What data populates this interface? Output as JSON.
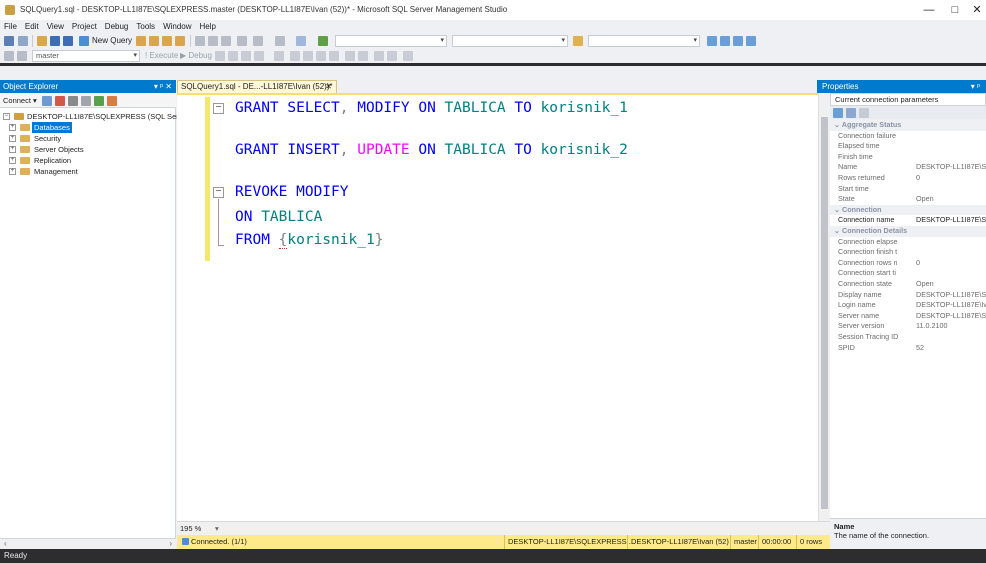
{
  "window": {
    "title": "SQLQuery1.sql - DESKTOP-LL1I87E\\SQLEXPRESS.master (DESKTOP-LL1I87E\\Ivan (52))* - Microsoft SQL Server Management Studio",
    "minimize": "—",
    "maximize": "□",
    "close": "✕"
  },
  "menu": [
    "File",
    "Edit",
    "View",
    "Project",
    "Debug",
    "Tools",
    "Window",
    "Help"
  ],
  "toolbar": {
    "new_query": "New Query",
    "database": "master",
    "execute": "Execute",
    "debug": "Debug"
  },
  "object_explorer": {
    "title": "Object Explorer",
    "controls": "▾ ᵖ ✕",
    "connect": "Connect ▾",
    "server_node": "DESKTOP-LL1I87E\\SQLEXPRESS (SQL Ser",
    "nodes": [
      "Databases",
      "Security",
      "Server Objects",
      "Replication",
      "Management"
    ]
  },
  "document_tab": {
    "label": "SQLQuery1.sql - DE...-LL1I87E\\Ivan (52))*",
    "close": "✕"
  },
  "editor": {
    "lines": [
      [
        [
          "kw",
          "GRANT SELECT"
        ],
        [
          "op",
          ","
        ],
        [
          "kw",
          " MODIFY ON "
        ],
        [
          "id",
          "TABLICA"
        ],
        [
          "kw",
          " TO "
        ],
        [
          "id",
          "korisnik_1"
        ]
      ],
      [],
      [
        [
          "kw",
          "GRANT INSERT"
        ],
        [
          "op",
          ","
        ],
        [
          "kw",
          " "
        ],
        [
          "fn",
          "UPDATE"
        ],
        [
          "kw",
          " ON "
        ],
        [
          "id",
          "TABLICA"
        ],
        [
          "kw",
          " TO "
        ],
        [
          "id",
          "korisnik_2"
        ]
      ],
      [],
      [
        [
          "kw",
          "REVOKE MODIFY"
        ]
      ],
      [
        [
          "kw",
          "ON "
        ],
        [
          "id",
          "TABLICA"
        ]
      ],
      [
        [
          "kw",
          "FROM "
        ],
        [
          "op",
          "{"
        ],
        [
          "id",
          "korisnik_1"
        ],
        [
          "op",
          "}"
        ]
      ]
    ],
    "zoom": "195 %"
  },
  "query_status": {
    "connected": "Connected. (1/1)",
    "server": "DESKTOP-LL1I87E\\SQLEXPRESS ...",
    "user": "DESKTOP-LL1I87E\\Ivan (52)",
    "database": "master",
    "elapsed": "00:00:00",
    "rows": "0 rows"
  },
  "properties": {
    "title": "Properties",
    "controls": "▾ ᵖ",
    "selected_object": "Current connection parameters",
    "rows": [
      {
        "type": "cat",
        "name": "Aggregate Status"
      },
      {
        "name": "Connection failure",
        "value": ""
      },
      {
        "name": "Elapsed time",
        "value": ""
      },
      {
        "name": "Finish time",
        "value": ""
      },
      {
        "name": "Name",
        "value": "DESKTOP-LL1I87E\\SC"
      },
      {
        "name": "Rows returned",
        "value": "0"
      },
      {
        "name": "Start time",
        "value": ""
      },
      {
        "name": "State",
        "value": "Open"
      },
      {
        "type": "cat",
        "name": "Connection"
      },
      {
        "name": "Connection name",
        "value": "DESKTOP-LL1I87E\\SC",
        "strong": true
      },
      {
        "type": "cat",
        "name": "Connection Details"
      },
      {
        "name": "Connection elapse",
        "value": ""
      },
      {
        "name": "Connection finish t",
        "value": ""
      },
      {
        "name": "Connection rows n",
        "value": "0"
      },
      {
        "name": "Connection start ti",
        "value": ""
      },
      {
        "name": "Connection state",
        "value": "Open"
      },
      {
        "name": "Display name",
        "value": "DESKTOP-LL1I87E\\SC"
      },
      {
        "name": "Login name",
        "value": "DESKTOP-LL1I87E\\Iva"
      },
      {
        "name": "Server name",
        "value": "DESKTOP-LL1I87E\\SC"
      },
      {
        "name": "Server version",
        "value": "11.0.2100"
      },
      {
        "name": "Session Tracing ID",
        "value": ""
      },
      {
        "name": "SPID",
        "value": "52"
      }
    ],
    "desc_title": "Name",
    "desc_text": "The name of the connection."
  },
  "status": {
    "ready": "Ready"
  },
  "colors": {
    "accent": "#007acc",
    "keyword": "#0000ff",
    "function": "#ff00ff",
    "identifier": "#008080",
    "status_bar": "#ffea8a"
  }
}
